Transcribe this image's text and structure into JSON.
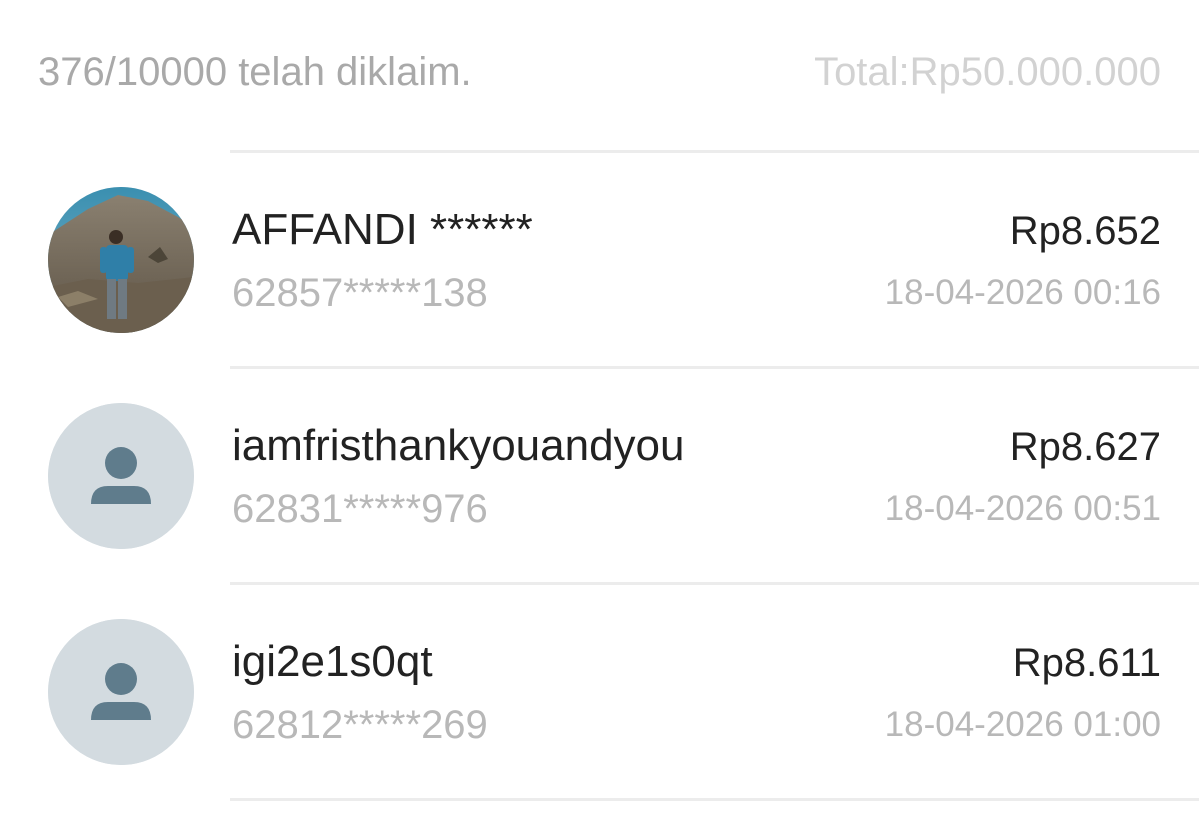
{
  "summary": {
    "claimed_text": "376/10000 telah diklaim.",
    "total_text": "Total:Rp50.000.000"
  },
  "claims": [
    {
      "name": "AFFANDI ******",
      "phone": "62857*****138",
      "amount": "Rp8.652",
      "time": "18-04-2026 00:16",
      "avatar": "photo"
    },
    {
      "name": "iamfristhankyouandyou",
      "phone": "62831*****976",
      "amount": "Rp8.627",
      "time": "18-04-2026 00:51",
      "avatar": "default-person-icon"
    },
    {
      "name": "igi2e1s0qt",
      "phone": "62812*****269",
      "amount": "Rp8.611",
      "time": "18-04-2026 01:00",
      "avatar": "default-person-icon"
    }
  ],
  "colors": {
    "avatar_bg": "#d3dbe0",
    "avatar_icon": "#5f7c8c",
    "divider": "#ececec"
  }
}
